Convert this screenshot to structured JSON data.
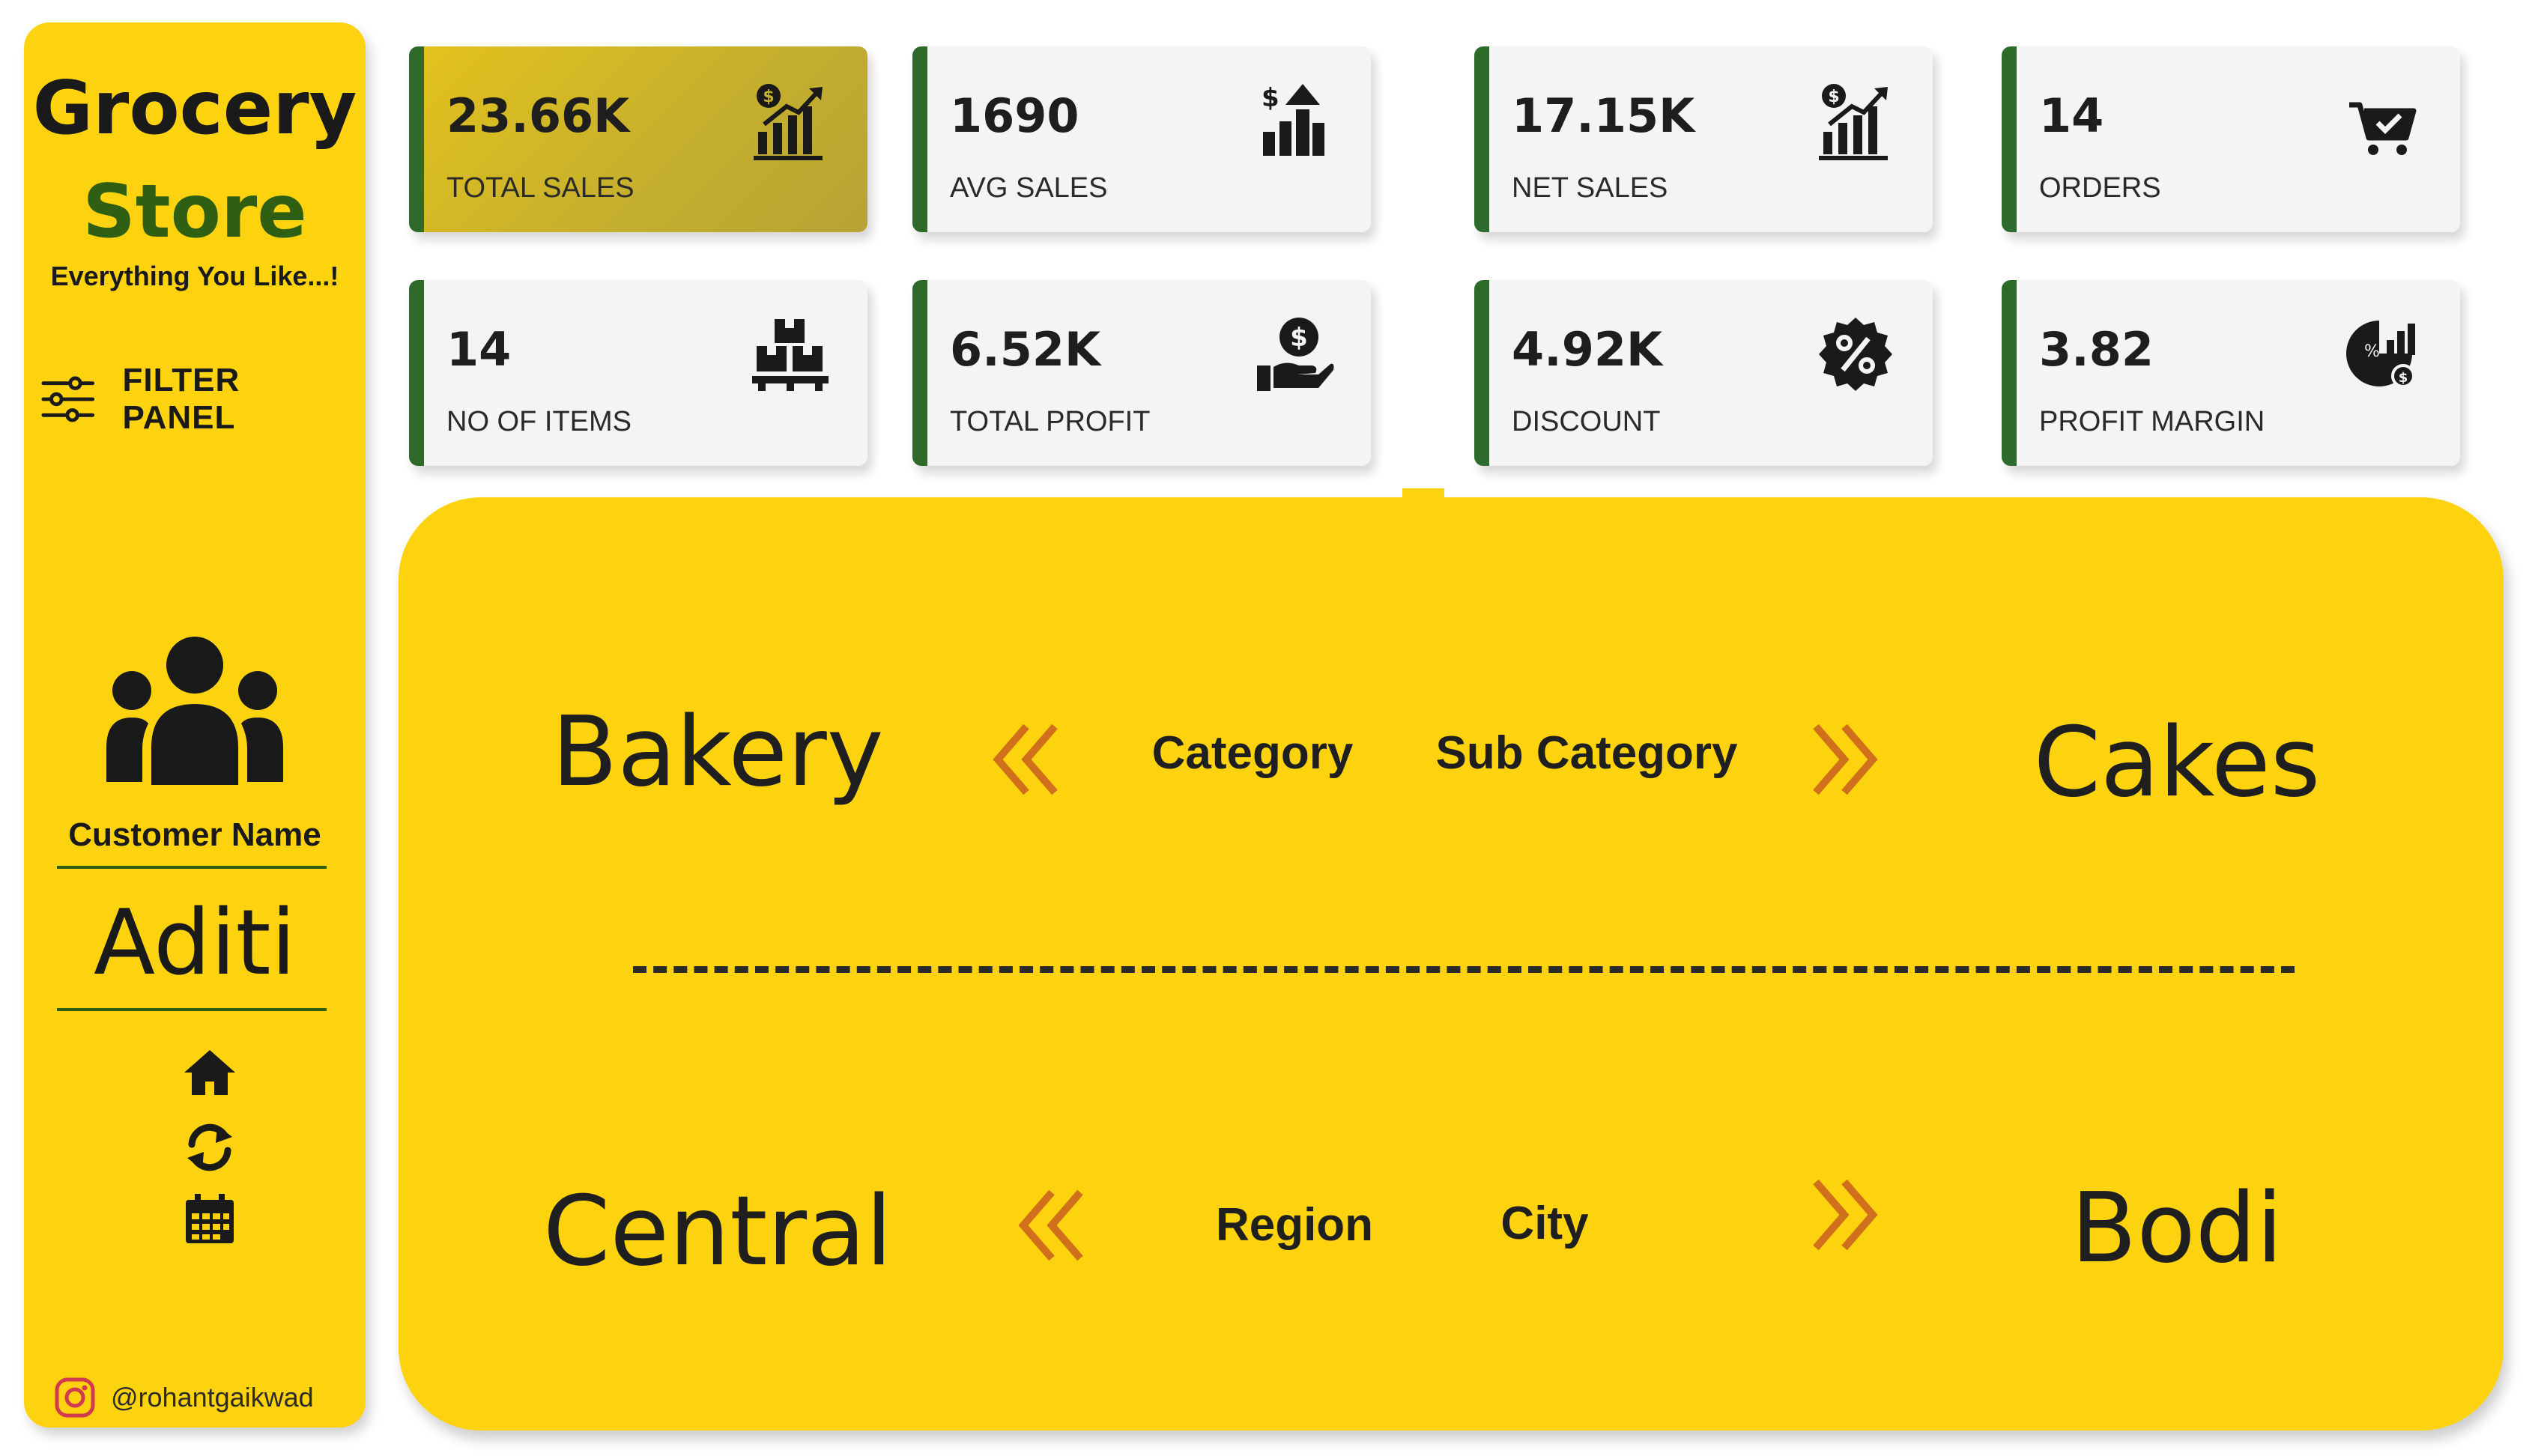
{
  "sidebar": {
    "brand_line1": "Grocery",
    "brand_line2": "Store",
    "tagline": "Everything You Like...!",
    "filter_panel_label": "FILTER PANEL",
    "customer_label": "Customer Name",
    "customer_value": "Aditi",
    "nav_icons": [
      "home-icon",
      "refresh-icon",
      "calendar-icon"
    ],
    "instagram_handle": "@rohantgaikwad"
  },
  "kpis": [
    {
      "value": "23.66K",
      "label": "TOTAL SALES",
      "icon": "sales-chart-icon"
    },
    {
      "value": "1690",
      "label": "AVG SALES",
      "icon": "avg-sales-icon"
    },
    {
      "value": "17.15K",
      "label": "NET SALES",
      "icon": "net-sales-icon"
    },
    {
      "value": "14",
      "label": "ORDERS",
      "icon": "cart-icon"
    },
    {
      "value": "14",
      "label": "NO OF ITEMS",
      "icon": "boxes-icon"
    },
    {
      "value": "6.52K",
      "label": "TOTAL PROFIT",
      "icon": "profit-hand-icon"
    },
    {
      "value": "4.92K",
      "label": "DISCOUNT",
      "icon": "discount-badge-icon"
    },
    {
      "value": "3.82",
      "label": "PROFIT MARGIN",
      "icon": "profit-margin-icon"
    }
  ],
  "selection": {
    "category_value": "Bakery",
    "category_label": "Category",
    "subcategory_label": "Sub Category",
    "subcategory_value": "Cakes",
    "region_value": "Central",
    "region_label": "Region",
    "city_label": "City",
    "city_value": "Bodi"
  },
  "colors": {
    "panel_yellow": "#fdd20f",
    "accent_green": "#2e6b2b",
    "brand_green": "#2e5f12",
    "chevron_orange": "#d1701c",
    "active_card": "#c6b02d"
  }
}
